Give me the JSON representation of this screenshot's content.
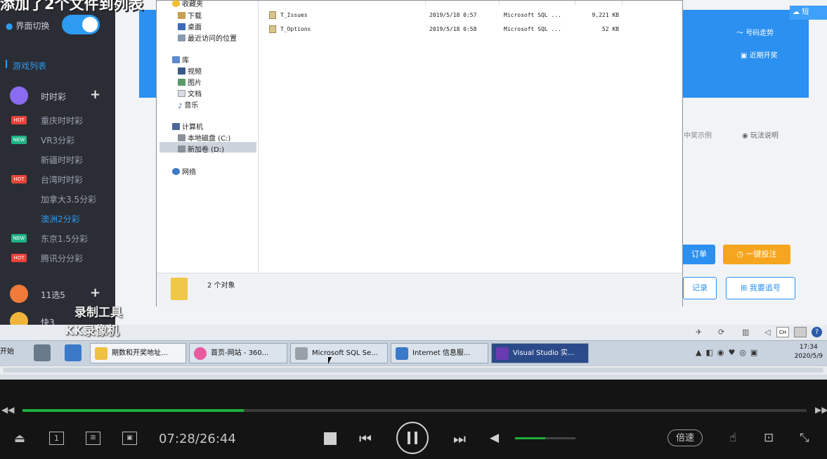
{
  "overlay": {
    "title": "添加了2个文件到列表",
    "watermark_line1": "录制工具",
    "watermark_line2": "KK录像机"
  },
  "game_sidebar": {
    "switch_label": "界面切换",
    "section_title": "游戏列表",
    "categories": [
      {
        "label": "时时彩",
        "icon_color": "#8a6cf0"
      },
      {
        "label": "11选5",
        "icon_color": "#f07a3a"
      },
      {
        "label": "快3",
        "icon_color": "#f0b43a"
      }
    ],
    "items": [
      {
        "label": "重庆时时彩",
        "badge": "HOT"
      },
      {
        "label": "VR3分彩",
        "badge": "NEW"
      },
      {
        "label": "新疆时时彩",
        "badge": ""
      },
      {
        "label": "台湾时时彩",
        "badge": "HOT"
      },
      {
        "label": "加拿大3.5分彩",
        "badge": ""
      },
      {
        "label": "澳洲2分彩",
        "badge": ""
      },
      {
        "label": "东京1.5分彩",
        "badge": "NEW"
      },
      {
        "label": "腾讯分分彩",
        "badge": "HOT"
      }
    ]
  },
  "web_page": {
    "trend_label": "号码走势",
    "recent_label": "近期开奖",
    "example_label": "中奖示例",
    "rules_label": "玩法说明",
    "order_label": "订单",
    "quick_bet_label": "一键投注",
    "record_label": "记录",
    "chase_label": "我要追号",
    "corner_label": "短"
  },
  "explorer": {
    "nav": {
      "favorites": "收藏夹",
      "downloads": "下载",
      "desktop": "桌面",
      "recent": "最近访问的位置",
      "libraries": "库",
      "videos": "视频",
      "pictures": "图片",
      "documents": "文档",
      "music": "音乐",
      "computer": "计算机",
      "drive_c": "本地磁盘 (C:)",
      "drive_d": "新加卷 (D:)",
      "network": "网络"
    },
    "files": [
      {
        "name": "T_Issues",
        "date": "2019/5/18 0:57",
        "type": "Microsoft SQL ...",
        "size": "9,221 KB"
      },
      {
        "name": "T_Options",
        "date": "2019/5/18 0:58",
        "type": "Microsoft SQL ...",
        "size": "52 KB"
      }
    ],
    "status": "2 个对象"
  },
  "taskbar": {
    "start_label": "开始",
    "tasks": [
      {
        "label": "期数和开奖地址...",
        "icon_color": "#f0c040"
      },
      {
        "label": "首页-网站 - 360...",
        "icon_color": "#e85aa0"
      },
      {
        "label": "Microsoft SQL Se...",
        "icon_color": "#9aa0a8"
      },
      {
        "label": "Internet 信息服...",
        "icon_color": "#3a7ac8"
      },
      {
        "label": "Visual Studio 实...",
        "icon_color": "#6a3ab0"
      }
    ],
    "lang": "CH",
    "clock_time": "17:34",
    "clock_date": "2020/5/9"
  },
  "player": {
    "time": "07:28/26:44",
    "progress": 0.282,
    "volume": 0.5,
    "speed_label": "倍速",
    "accent_color": "#1fae3a"
  }
}
